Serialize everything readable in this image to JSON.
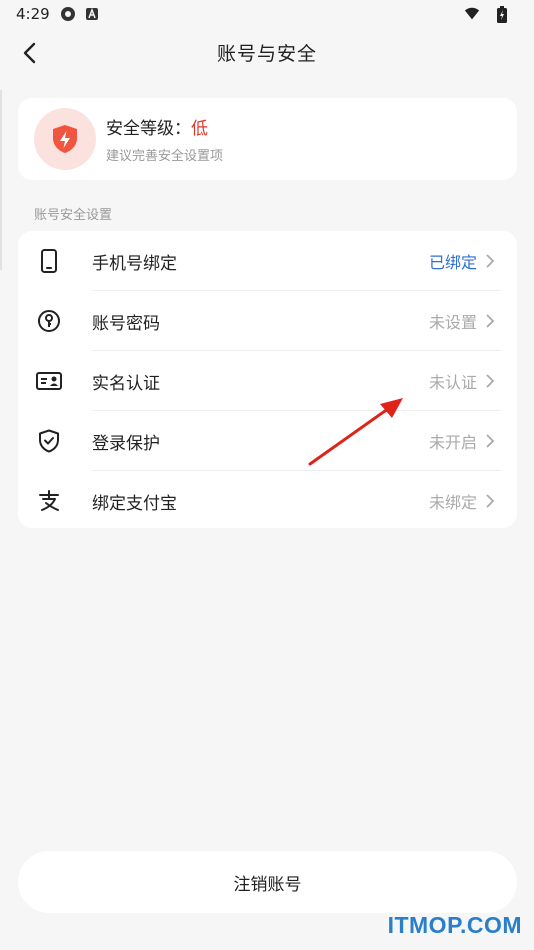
{
  "status_bar": {
    "time": "4:29",
    "icons": [
      "settings-gear-icon",
      "a-badge-icon",
      "wifi-icon",
      "battery-charging-icon"
    ]
  },
  "nav": {
    "title": "账号与安全",
    "back_icon": "back-arrow-icon"
  },
  "security_level": {
    "icon": "shield-lightning-icon",
    "label": "安全等级：",
    "level": "低",
    "level_color": "#e0392e",
    "hint": "建议完善安全设置项"
  },
  "section_title": "账号安全设置",
  "settings": [
    {
      "icon": "phone-icon",
      "label": "手机号绑定",
      "value": "已绑定",
      "value_color": "#2f6fd6"
    },
    {
      "icon": "key-icon",
      "label": "账号密码",
      "value": "未设置",
      "value_color": "#aaaaaa"
    },
    {
      "icon": "id-card-icon",
      "label": "实名认证",
      "value": "未认证",
      "value_color": "#aaaaaa"
    },
    {
      "icon": "shield-check-icon",
      "label": "登录保护",
      "value": "未开启",
      "value_color": "#aaaaaa"
    },
    {
      "icon": "alipay-icon",
      "label": "绑定支付宝",
      "value": "未绑定",
      "value_color": "#aaaaaa"
    }
  ],
  "logout_button": "注销账号",
  "watermark": "ITMOP.COM"
}
